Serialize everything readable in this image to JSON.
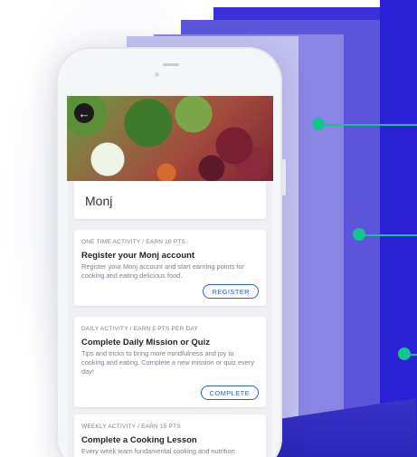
{
  "theme": {
    "c0": "#2a20d6",
    "c1": "#3a31d8",
    "c2": "#5c55db",
    "c3": "#8a85e4",
    "c4": "#c4c2f1",
    "green": "#14c38e"
  },
  "app": {
    "name": "Monj"
  },
  "header": {
    "back_icon": "arrow-left-icon",
    "back_glyph": "←"
  },
  "activities": [
    {
      "kicker": "ONE TIME ACTIVITY / EARN 10 PTS",
      "title": "Register your Monj account",
      "description": "Register your Monj account and start earning points for cooking and eating delicious food.",
      "button": "REGISTER"
    },
    {
      "kicker": "DAILY ACTIVITY / EARN 5 PTS PER DAY",
      "title": "Complete Daily Mission or Quiz",
      "description": "Tips and tricks to bring more mindfulness and joy to cooking and eating. Complete a new mission or quiz every day!",
      "button": "COMPLETE"
    },
    {
      "kicker": "WEEKLY ACTIVITY / EARN 15 PTS",
      "title": "Complete a Cooking Lesson",
      "description": "Every week learn fundamental cooking and nutrition"
    }
  ]
}
